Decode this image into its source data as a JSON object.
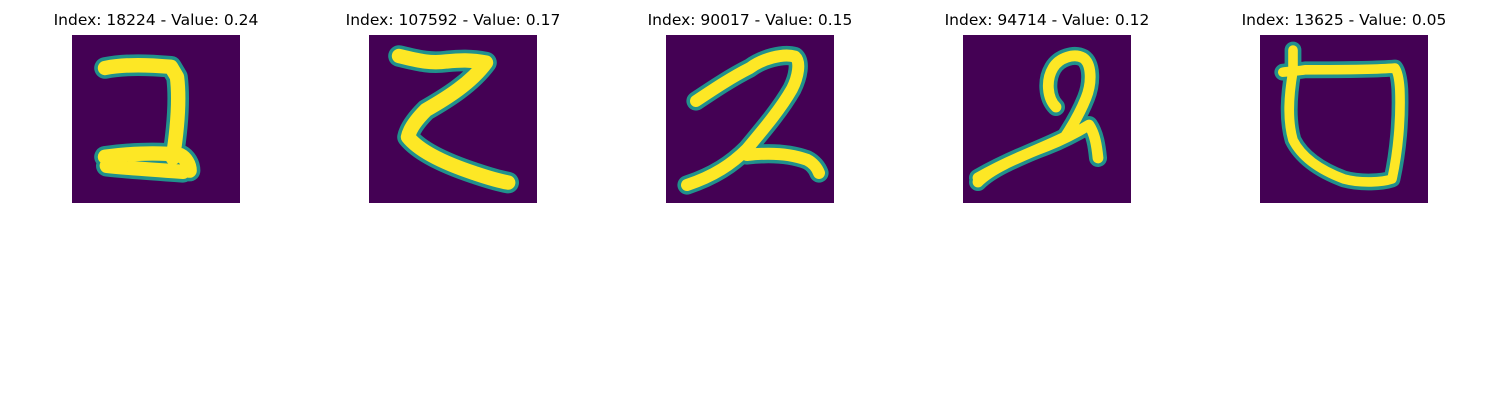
{
  "figure": {
    "panels": [
      {
        "title": "Index: 18224 - Value: 0.24",
        "glyph": "digit-2-boxy"
      },
      {
        "title": "Index: 107592 - Value: 0.17",
        "glyph": "digit-2-z-shaped"
      },
      {
        "title": "Index: 90017 - Value: 0.15",
        "glyph": "digit-2-cursive"
      },
      {
        "title": "Index: 94714 - Value: 0.12",
        "glyph": "digit-2-looped"
      },
      {
        "title": "Index: 13625 - Value: 0.05",
        "glyph": "digit-2-cup-shaped"
      }
    ],
    "colormap": {
      "background": "#440154",
      "edge": "#21918c",
      "foreground": "#fde725"
    }
  }
}
